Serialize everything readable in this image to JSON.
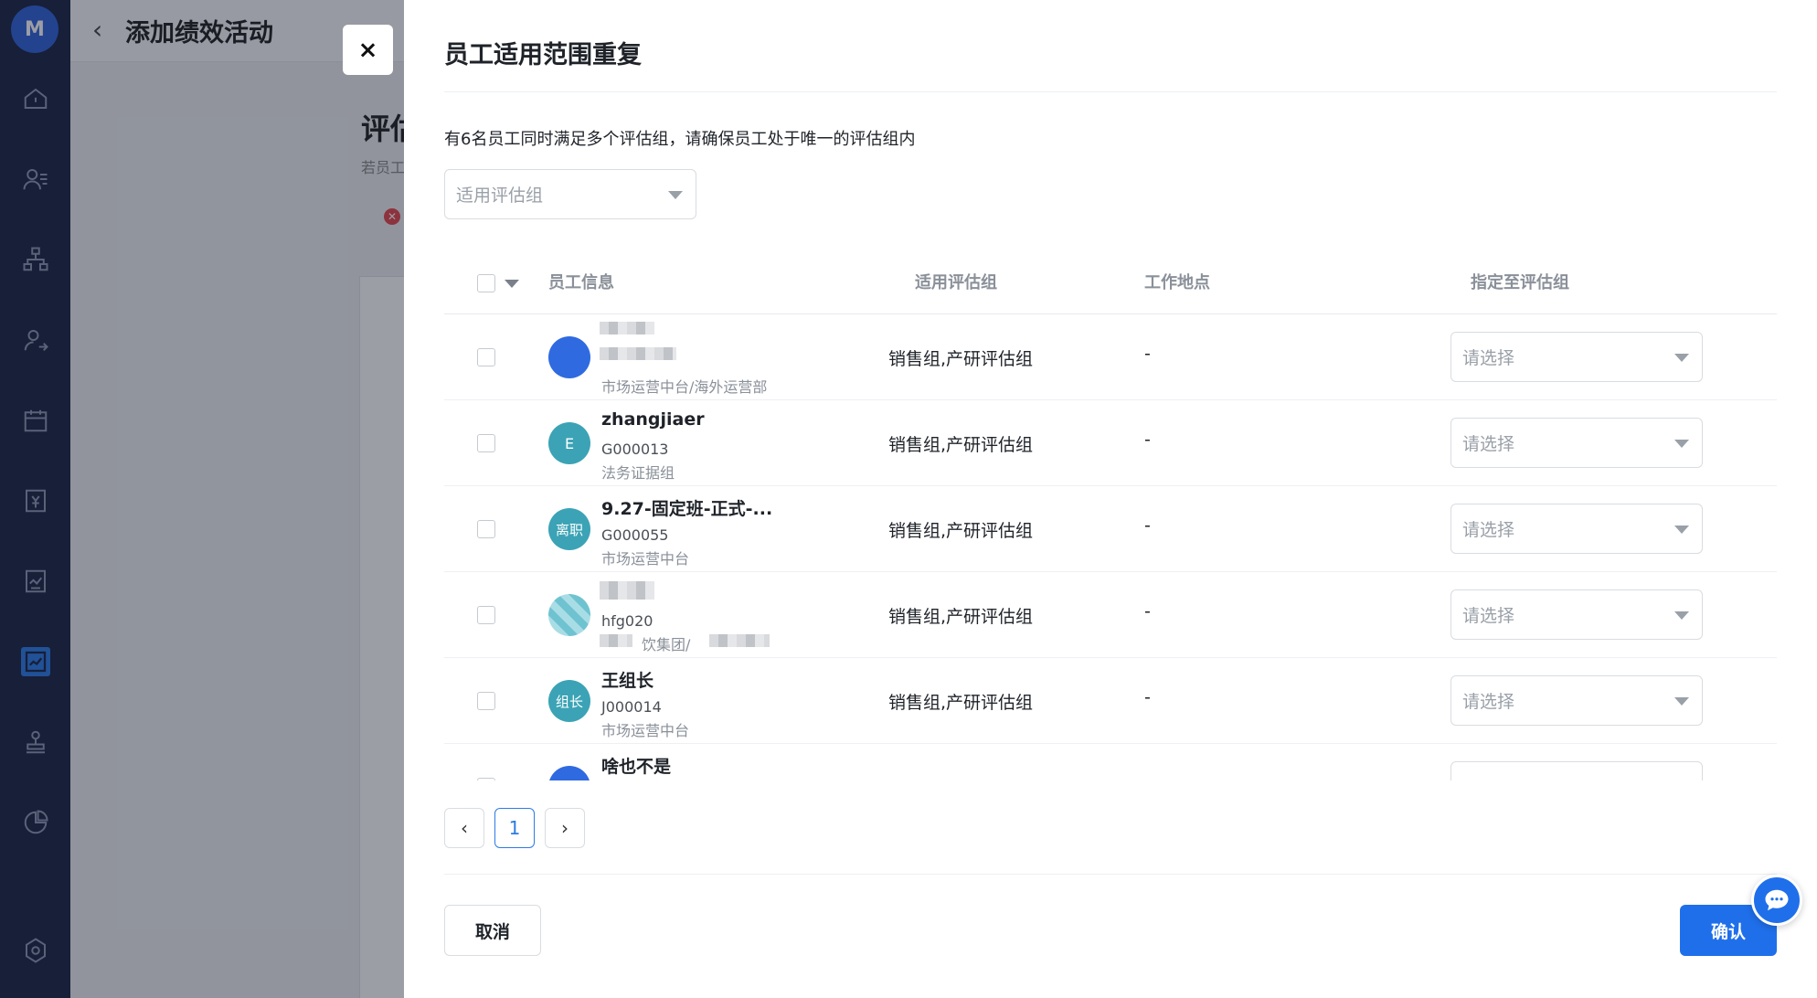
{
  "background": {
    "title": "添加绩效活动",
    "heading": "评估",
    "subtitle": "若员工"
  },
  "drawer": {
    "title": "员工适用范围重复",
    "description": "有6名员工同时满足多个评估组，请确保员工处于唯一的评估组内",
    "filter_placeholder": "适用评估组",
    "columns": {
      "employee": "员工信息",
      "groups": "适用评估组",
      "location": "工作地点",
      "assign": "指定至评估组"
    },
    "rows": [
      {
        "avatar": "",
        "name": "",
        "code": "",
        "dept": "市场运营中台/海外运营部",
        "groups": "销售组,产研评估组",
        "location": "-",
        "assign": "请选择"
      },
      {
        "avatar": "E",
        "name": "zhangjiaer",
        "code": "G000013",
        "dept": "法务证据组",
        "groups": "销售组,产研评估组",
        "location": "-",
        "assign": "请选择"
      },
      {
        "avatar": "离职",
        "name": "9.27-固定班-正式-...",
        "code": "G000055",
        "dept": "市场运营中台",
        "groups": "销售组,产研评估组",
        "location": "-",
        "assign": "请选择"
      },
      {
        "avatar": "",
        "name": "",
        "code": "hfg020",
        "dept": "饮集团/",
        "groups": "销售组,产研评估组",
        "location": "-",
        "assign": "请选择"
      },
      {
        "avatar": "组长",
        "name": "王组长",
        "code": "J000014",
        "dept": "市场运营中台",
        "groups": "销售组,产研评估组",
        "location": "-",
        "assign": "请选择"
      },
      {
        "avatar": "",
        "name": "啥也不是",
        "code": "",
        "dept": "",
        "groups": "",
        "location": "",
        "assign": ""
      }
    ],
    "pagination": {
      "prev": "‹",
      "page": "1",
      "next": "›"
    },
    "cancel_label": "取消",
    "confirm_label": "确认"
  },
  "colors": {
    "primary": "#1f6fea",
    "nav_bg": "#1b2545",
    "avatar_teal": "#3ba3b5",
    "avatar_blue": "#2f6ae0"
  }
}
